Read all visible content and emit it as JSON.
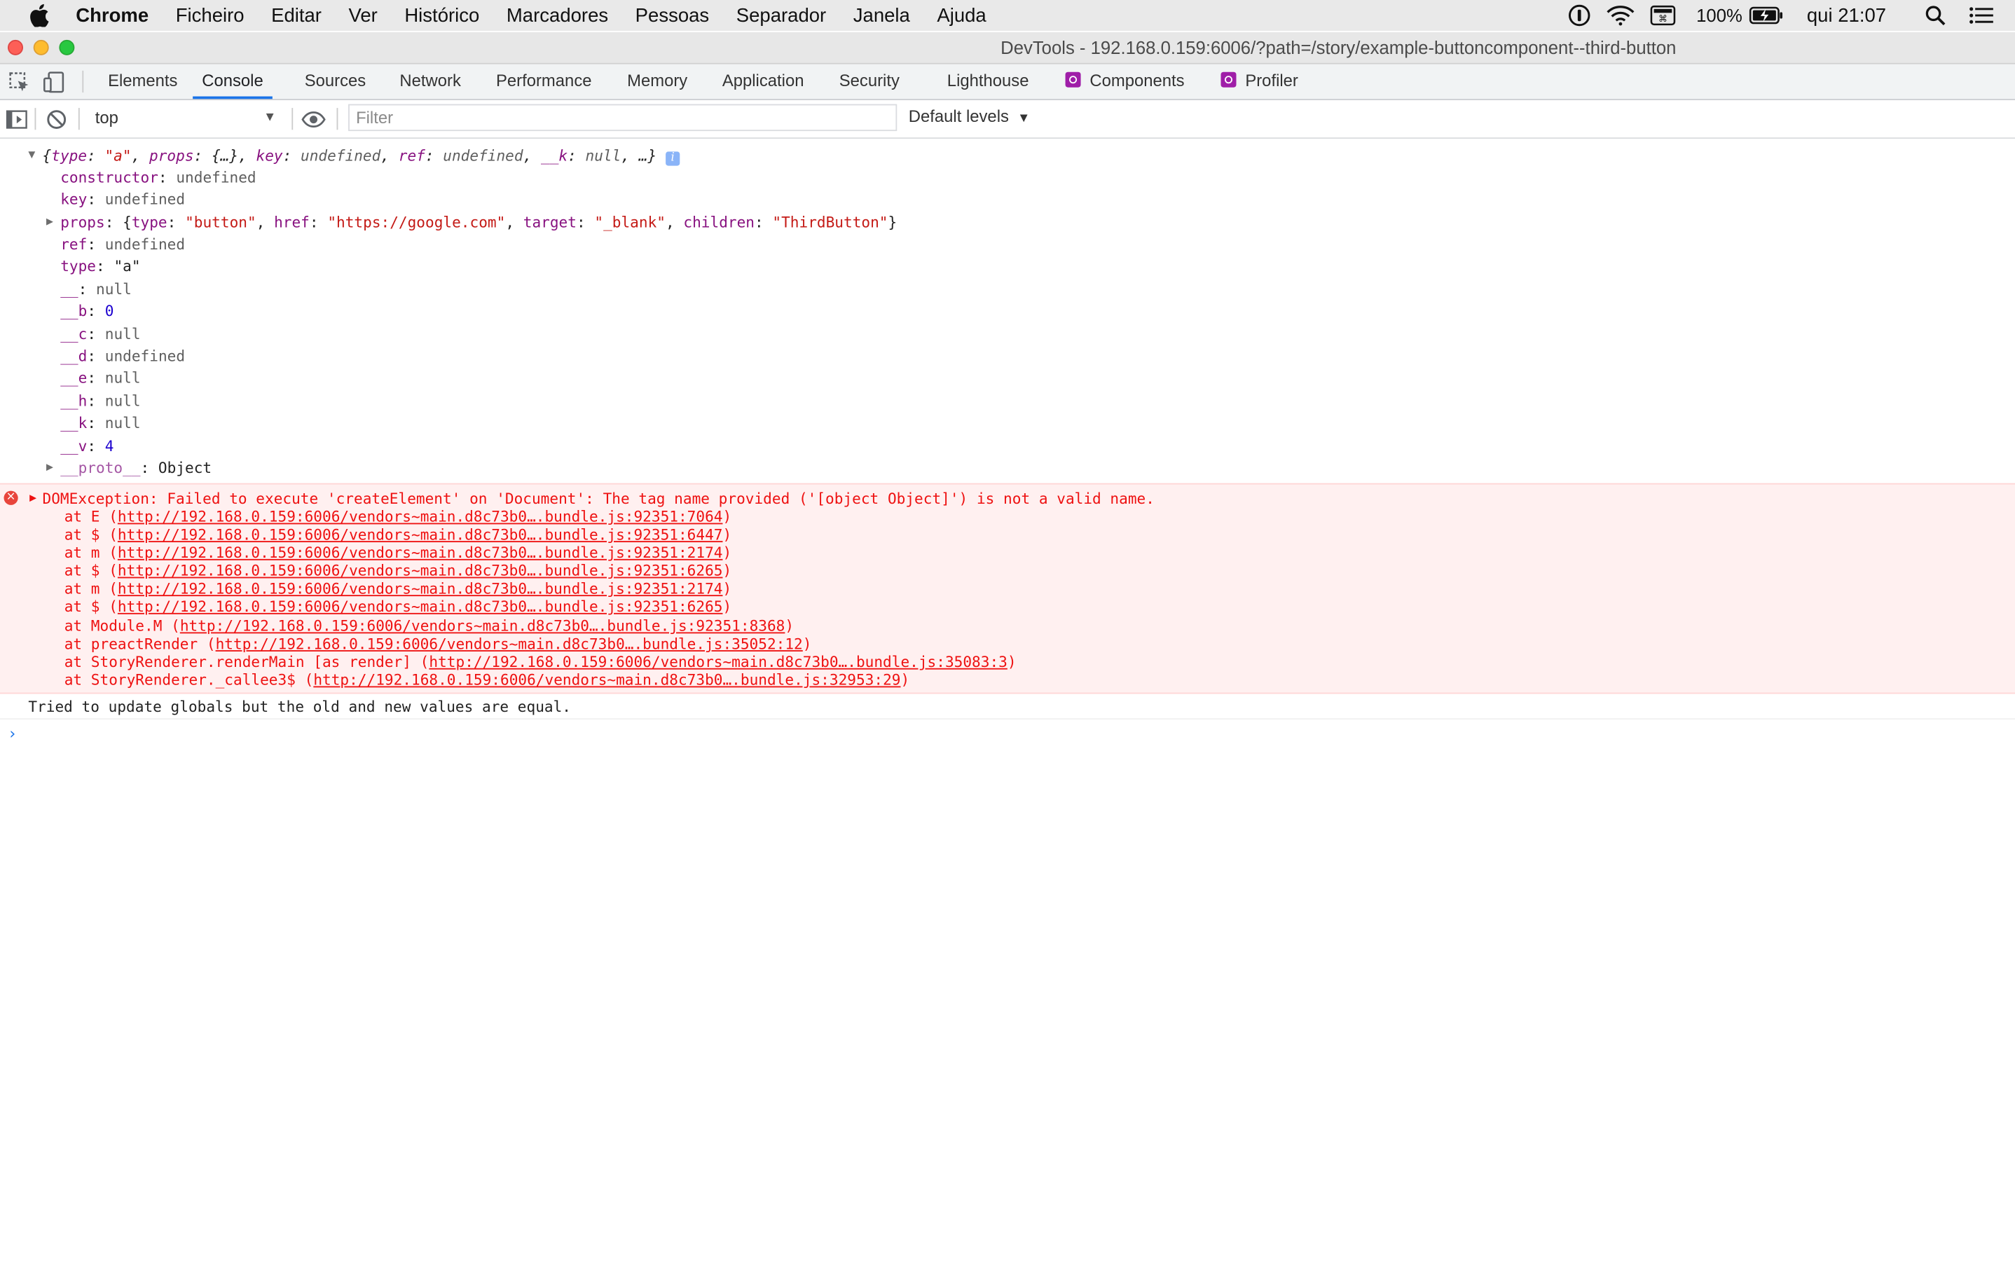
{
  "menubar": {
    "items": [
      "Chrome",
      "Ficheiro",
      "Editar",
      "Ver",
      "Histórico",
      "Marcadores",
      "Pessoas",
      "Separador",
      "Janela",
      "Ajuda"
    ],
    "status": {
      "battery": "100%",
      "clock": "qui 21:07"
    }
  },
  "window": {
    "title": "DevTools - 192.168.0.159:6006/?path=/story/example-buttoncomponent--third-button"
  },
  "devtools": {
    "tabs": [
      "Elements",
      "Console",
      "Sources",
      "Network",
      "Performance",
      "Memory",
      "Application",
      "Security",
      "Lighthouse",
      "Components",
      "Profiler"
    ],
    "active_tab": "Console"
  },
  "console_toolbar": {
    "context": "top",
    "filter_placeholder": "Filter",
    "levels": "Default levels"
  },
  "object_log": {
    "summary": {
      "open": "{",
      "type_key": "type",
      "type_val": "\"a\"",
      "props_key": "props",
      "props_val": "{…}",
      "key_key": "key",
      "key_val": "undefined",
      "ref_key": "ref",
      "ref_val": "undefined",
      "k_key": "__k",
      "k_val": "null",
      "close": "…}"
    },
    "properties": [
      {
        "key": "constructor",
        "value": "undefined",
        "kind": "nul"
      },
      {
        "key": "key",
        "value": "undefined",
        "kind": "nul"
      },
      {
        "key": "props",
        "value": "",
        "kind": "props"
      },
      {
        "key": "ref",
        "value": "undefined",
        "kind": "nul"
      },
      {
        "key": "type",
        "value": "\"a\"",
        "kind": "plain"
      },
      {
        "key": "__",
        "value": "null",
        "kind": "nul"
      },
      {
        "key": "__b",
        "value": "0",
        "kind": "num"
      },
      {
        "key": "__c",
        "value": "null",
        "kind": "nul"
      },
      {
        "key": "__d",
        "value": "undefined",
        "kind": "nul"
      },
      {
        "key": "__e",
        "value": "null",
        "kind": "nul"
      },
      {
        "key": "__h",
        "value": "null",
        "kind": "nul"
      },
      {
        "key": "__k",
        "value": "null",
        "kind": "nul"
      },
      {
        "key": "__v",
        "value": "4",
        "kind": "num"
      },
      {
        "key": "__proto__",
        "value": "Object",
        "kind": "proto"
      }
    ],
    "props_detail": {
      "type_val": "\"button\"",
      "href_val": "\"https://google.com\"",
      "target_val": "\"_blank\"",
      "children_val": "\"ThirdButton\""
    }
  },
  "error": {
    "message": "DOMException: Failed to execute 'createElement' on 'Document': The tag name provided ('[object Object]') is not a valid name.",
    "stack": [
      {
        "fn": "at E (",
        "url": "http://192.168.0.159:6006/vendors~main.d8c73b0….bundle.js:92351:7064",
        "end": ")"
      },
      {
        "fn": "at $ (",
        "url": "http://192.168.0.159:6006/vendors~main.d8c73b0….bundle.js:92351:6447",
        "end": ")"
      },
      {
        "fn": "at m (",
        "url": "http://192.168.0.159:6006/vendors~main.d8c73b0….bundle.js:92351:2174",
        "end": ")"
      },
      {
        "fn": "at $ (",
        "url": "http://192.168.0.159:6006/vendors~main.d8c73b0….bundle.js:92351:6265",
        "end": ")"
      },
      {
        "fn": "at m (",
        "url": "http://192.168.0.159:6006/vendors~main.d8c73b0….bundle.js:92351:2174",
        "end": ")"
      },
      {
        "fn": "at $ (",
        "url": "http://192.168.0.159:6006/vendors~main.d8c73b0….bundle.js:92351:6265",
        "end": ")"
      },
      {
        "fn": "at Module.M (",
        "url": "http://192.168.0.159:6006/vendors~main.d8c73b0….bundle.js:92351:8368",
        "end": ")"
      },
      {
        "fn": "at preactRender (",
        "url": "http://192.168.0.159:6006/vendors~main.d8c73b0….bundle.js:35052:12",
        "end": ")"
      },
      {
        "fn": "at StoryRenderer.renderMain [as render] (",
        "url": "http://192.168.0.159:6006/vendors~main.d8c73b0….bundle.js:35083:3",
        "end": ")"
      },
      {
        "fn": "at StoryRenderer._callee3$ (",
        "url": "http://192.168.0.159:6006/vendors~main.d8c73b0….bundle.js:32953:29",
        "end": ")"
      }
    ]
  },
  "log_message": "Tried to update globals but the old and new values are equal.",
  "prompt_symbol": "›",
  "colors": {
    "accent": "#1a73e8",
    "error_text": "#ee1111",
    "error_bg": "#fff0f0",
    "key_purple": "#881280",
    "string_red": "#c41a16",
    "number_blue": "#1c00cf"
  }
}
